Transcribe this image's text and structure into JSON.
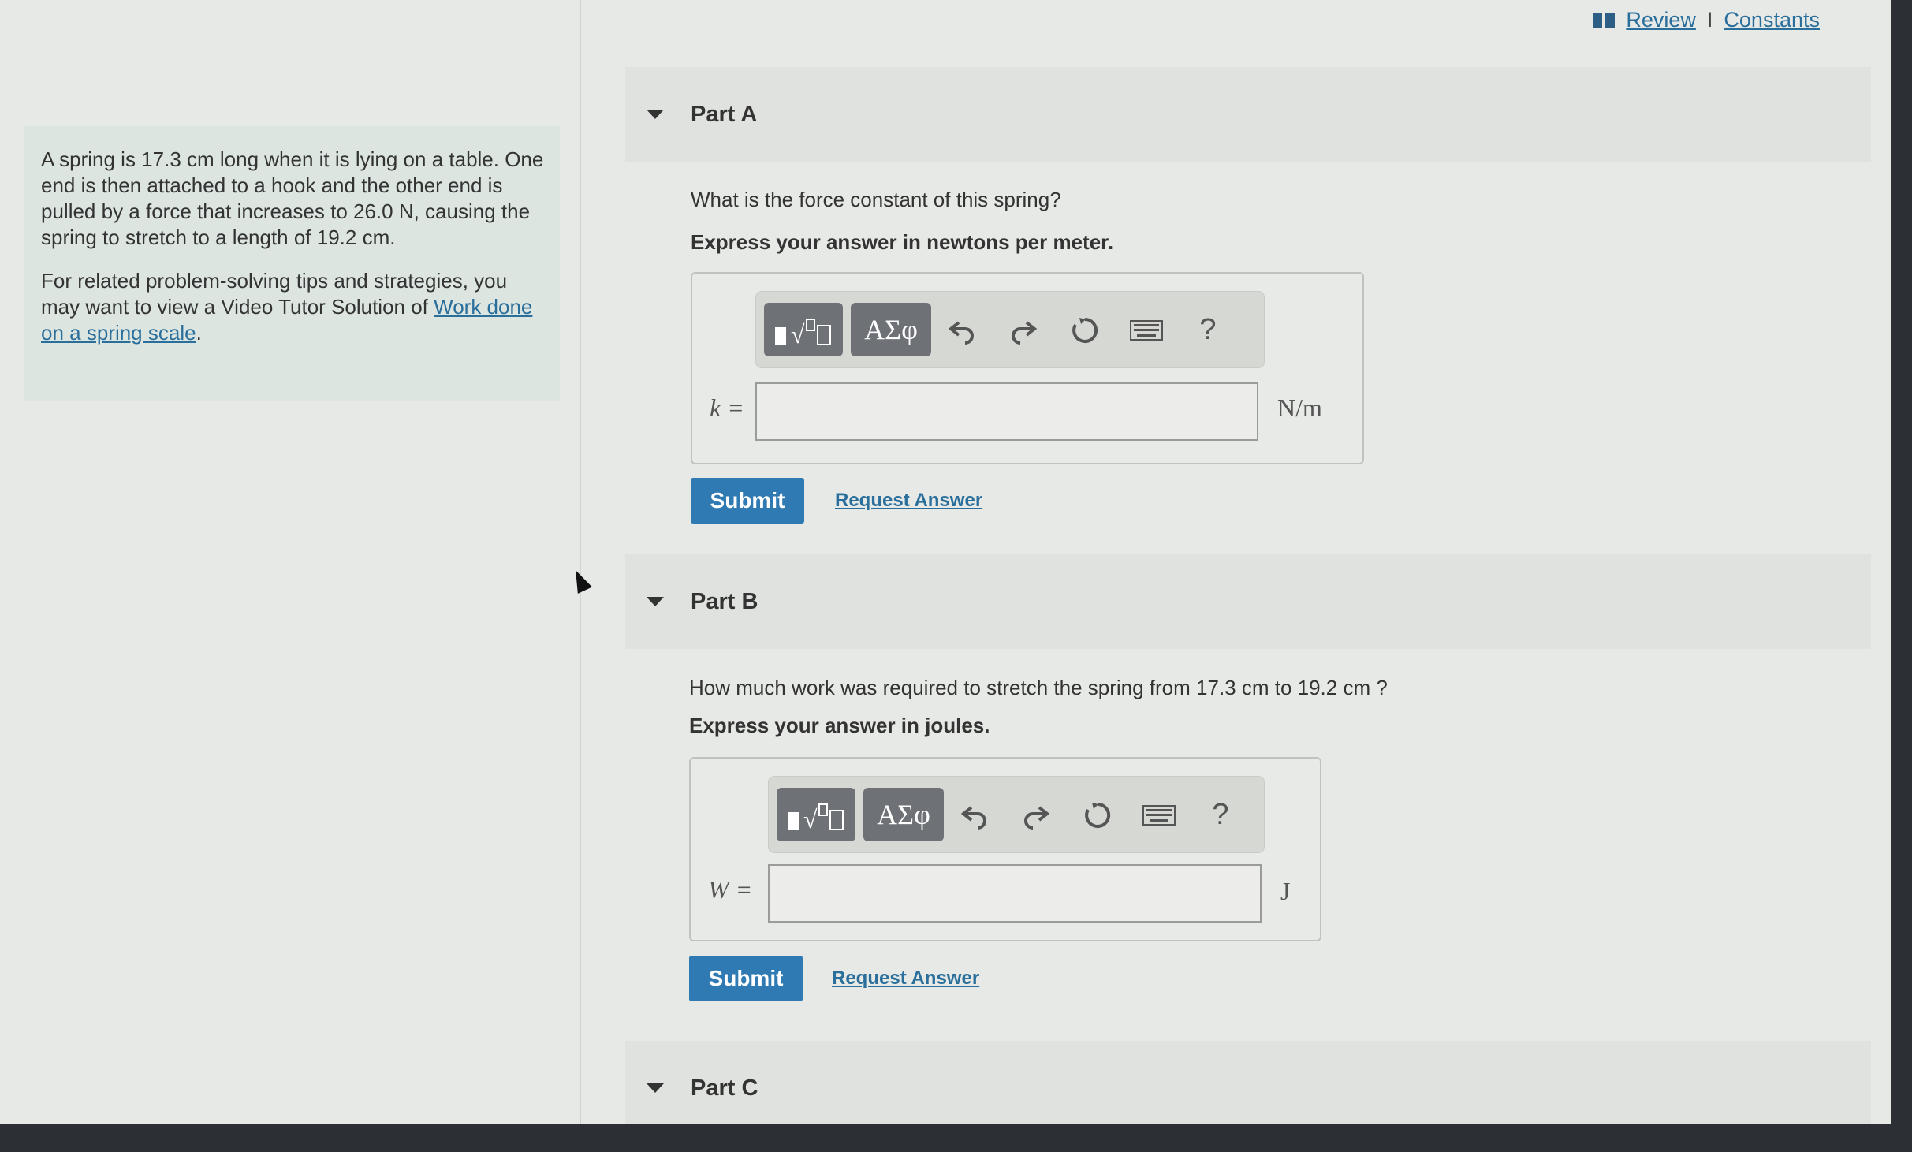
{
  "header": {
    "review_label": "Review",
    "separator": "I",
    "constants_label": "Constants"
  },
  "problem": {
    "para1": "A spring is 17.3 cm long when it is lying on a table. One end is then attached to a hook and the other end is pulled by a force that increases to 26.0 N, causing the spring to stretch to a length of 19.2 cm.",
    "para2_prefix": "For related problem-solving tips and strategies, you may want to view a Video Tutor Solution of",
    "link": "Work done on a spring scale",
    "para2_suffix": "."
  },
  "parts": [
    {
      "title": "Part A",
      "question": "What is the force constant of this spring?",
      "instruction": "Express your answer in newtons per meter.",
      "variable": "k =",
      "unit": "N/m",
      "input_value": "",
      "submit": "Submit",
      "request": "Request Answer"
    },
    {
      "title": "Part B",
      "question": "How much work was required to stretch the spring from 17.3 cm to 19.2 cm ?",
      "instruction": "Express your answer in joules.",
      "variable": "W =",
      "unit": "J",
      "input_value": "",
      "submit": "Submit",
      "request": "Request Answer"
    },
    {
      "title": "Part C"
    }
  ],
  "toolbar": {
    "greek_label": "ΑΣφ",
    "help_label": "?",
    "icons": [
      "templates-icon",
      "greek-letters-icon",
      "undo-icon",
      "redo-icon",
      "reset-icon",
      "keyboard-icon",
      "help-icon"
    ]
  }
}
